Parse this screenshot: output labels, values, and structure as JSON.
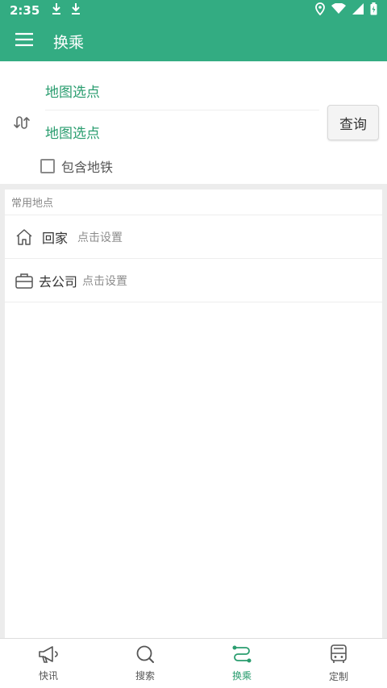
{
  "status_bar": {
    "time": "2:35"
  },
  "app_bar": {
    "title": "换乘"
  },
  "route": {
    "from_label": "地图选点",
    "to_label": "地图选点",
    "query_label": "查询",
    "subway_label": "包含地铁"
  },
  "places": {
    "header": "常用地点",
    "home": {
      "name": "回家",
      "hint": "点击设置"
    },
    "work": {
      "name": "去公司",
      "hint": "点击设置"
    }
  },
  "nav": {
    "items": [
      {
        "label": "快讯"
      },
      {
        "label": "搜索"
      },
      {
        "label": "换乘"
      },
      {
        "label": "定制"
      }
    ]
  },
  "colors": {
    "brand": "#33ac82",
    "accent_text": "#2a9d6f"
  }
}
